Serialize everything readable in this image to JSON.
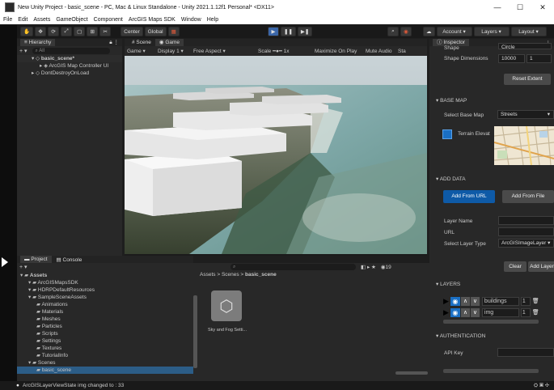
{
  "window": {
    "title": "New Unity Project - basic_scene - PC, Mac & Linux Standalone - Unity 2021.1.12f1 Personal* <DX11>",
    "min": "—",
    "max": "☐",
    "close": "✕"
  },
  "menu": [
    "File",
    "Edit",
    "Assets",
    "GameObject",
    "Component",
    "ArcGIS Maps SDK",
    "Window",
    "Help"
  ],
  "toolbar": {
    "center": "Center",
    "global": "Global",
    "account": "Account",
    "layers": "Layers",
    "layout": "Layout"
  },
  "hierarchy": {
    "tab": "Hierarchy",
    "search": "All",
    "items": [
      "basic_scene*",
      "ArcGIS Map Controller UI",
      "DontDestroyOnLoad"
    ]
  },
  "viewtabs": {
    "scene": "Scene",
    "game": "Game"
  },
  "gamebar": {
    "mode": "Game",
    "display": "Display 1",
    "aspect": "Free Aspect",
    "scale_label": "Scale",
    "scale_value": "1x",
    "maximize": "Maximize On Play",
    "mute": "Mute Audio",
    "stats": "Sta"
  },
  "project": {
    "tab_project": "Project",
    "tab_console": "Console",
    "tree": [
      {
        "label": "Assets",
        "indent": 0,
        "bold": true
      },
      {
        "label": "ArcGISMapsSDK",
        "indent": 1
      },
      {
        "label": "HDRPDefaultResources",
        "indent": 1
      },
      {
        "label": "SampleSceneAssets",
        "indent": 1
      },
      {
        "label": "Animations",
        "indent": 2
      },
      {
        "label": "Materials",
        "indent": 2
      },
      {
        "label": "Meshes",
        "indent": 2
      },
      {
        "label": "Particles",
        "indent": 2
      },
      {
        "label": "Scripts",
        "indent": 2
      },
      {
        "label": "Settings",
        "indent": 2
      },
      {
        "label": "Textures",
        "indent": 2
      },
      {
        "label": "TutorialInfo",
        "indent": 2
      },
      {
        "label": "Scenes",
        "indent": 1
      },
      {
        "label": "basic_scene",
        "indent": 2
      }
    ],
    "breadcrumb": [
      "Assets",
      "Scenes",
      "basic_scene"
    ],
    "asset_label": "Sky and Fog Setti...",
    "count": "19"
  },
  "inspector": {
    "tab": "Inspector",
    "shape_label": "Shape",
    "shape_value": "Circle",
    "dims_label": "Shape Dimensions",
    "dim1": "10000",
    "dim2": "1",
    "reset_extent": "Reset Extent",
    "basemap_section": "BASE MAP",
    "select_basemap_label": "Select Base Map",
    "basemap_value": "Streets",
    "terrain_label": "Terrain Elevat",
    "add_data_section": "ADD DATA",
    "add_from_url": "Add From URL",
    "add_from_file": "Add From File",
    "layer_name_label": "Layer Name",
    "url_label": "URL",
    "layer_type_label": "Select Layer Type",
    "layer_type_value": "ArcGISImageLayer",
    "clear": "Clear",
    "add_layer": "Add Layer",
    "layers_section": "LAYERS",
    "layers": [
      {
        "name": "buildings",
        "opacity": "1"
      },
      {
        "name": "img",
        "opacity": "1"
      }
    ],
    "auth_section": "AUTHENTICATION",
    "api_key_label": "API Key"
  },
  "status": {
    "text": "ArcGISLayerViewState img changed to : 33"
  }
}
